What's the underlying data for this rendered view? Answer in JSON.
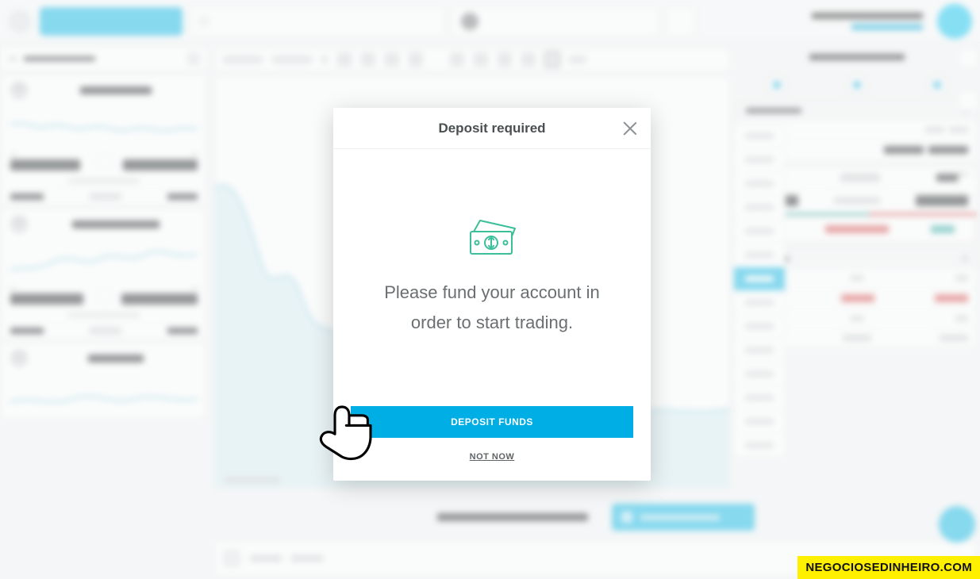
{
  "topbar": {
    "primary_button": "",
    "search_big_text": "",
    "search_small_text": ""
  },
  "modal": {
    "title": "Deposit required",
    "message": "Please fund your account in order to start trading.",
    "deposit_button": "DEPOSIT FUNDS",
    "not_now": "NOT NOW"
  },
  "bottom": {
    "label": "",
    "open_position_button": ""
  },
  "watermark": "NEGOCIOSEDINHEIRO.COM"
}
